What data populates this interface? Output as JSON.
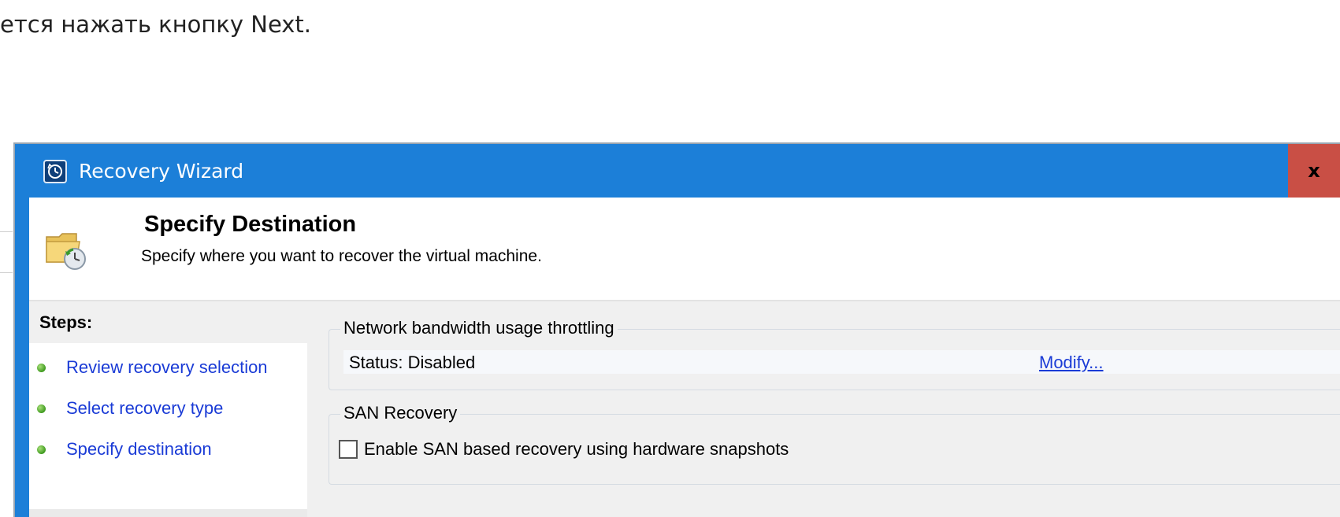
{
  "article": {
    "text": "ется нажать кнопку Next."
  },
  "window": {
    "title": "Recovery Wizard",
    "close_label": "x",
    "icon": "clock-app-icon"
  },
  "header": {
    "title": "Specify Destination",
    "subtitle": "Specify where you want to recover the virtual machine.",
    "icon": "folder-restore-icon"
  },
  "steps": {
    "heading": "Steps:",
    "items": [
      {
        "label": "Review recovery selection",
        "status": "completed"
      },
      {
        "label": "Select recovery type",
        "status": "completed"
      },
      {
        "label": "Specify destination",
        "status": "current"
      }
    ]
  },
  "throttling": {
    "group_label": "Network bandwidth usage throttling",
    "status": "Status: Disabled",
    "modify_link": "Modify..."
  },
  "san": {
    "group_label": "SAN Recovery",
    "checkbox_label": "Enable SAN based recovery using hardware snapshots",
    "checked": false
  },
  "colors": {
    "titlebar": "#1c7fd8",
    "close_button": "#c94f45",
    "link": "#1a3bd6",
    "step_dot": "#3f9a1f"
  }
}
